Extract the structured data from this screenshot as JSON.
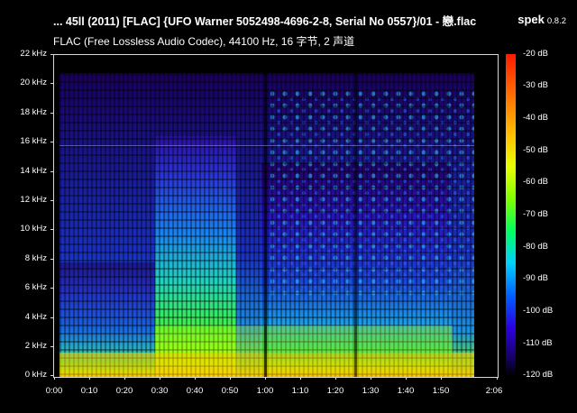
{
  "header": {
    "title": "... 45ll (2011) [FLAC] {UFO Warner 5052498-4696-2-8, Serial No 0557}/01 - 戀.flac",
    "app_name": "spek",
    "app_version": "0.8.2",
    "subtitle": "FLAC (Free Lossless Audio Codec), 44100 Hz, 16 字节, 2 声道"
  },
  "y_axis": {
    "labels": [
      "22 kHz",
      "20 kHz",
      "18 kHz",
      "16 kHz",
      "14 kHz",
      "12 kHz",
      "10 kHz",
      "8 kHz",
      "6 kHz",
      "4 kHz",
      "2 kHz",
      "0 kHz"
    ]
  },
  "x_axis": {
    "labels": [
      "0:00",
      "0:10",
      "0:20",
      "0:30",
      "0:40",
      "0:50",
      "1:00",
      "1:10",
      "1:20",
      "1:30",
      "1:40",
      "1:50",
      "2:06"
    ]
  },
  "db_scale": {
    "labels": [
      "-20 dB",
      "-30 dB",
      "-40 dB",
      "-50 dB",
      "-60 dB",
      "-70 dB",
      "-80 dB",
      "-90 dB",
      "-100 dB",
      "-110 dB",
      "-120 dB"
    ]
  }
}
